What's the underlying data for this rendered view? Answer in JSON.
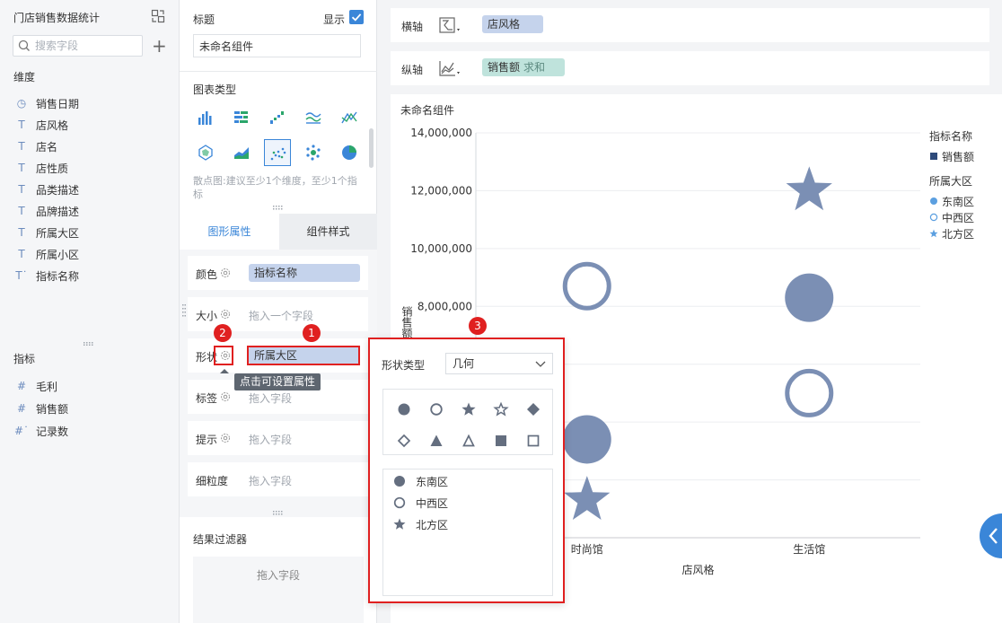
{
  "dataset": {
    "title": "门店销售数据统计",
    "search_placeholder": "搜索字段"
  },
  "dimensions": {
    "label": "维度",
    "items": [
      {
        "icon": "clock-icon",
        "label": "销售日期"
      },
      {
        "icon": "text-icon",
        "label": "店风格"
      },
      {
        "icon": "text-icon",
        "label": "店名"
      },
      {
        "icon": "text-icon",
        "label": "店性质"
      },
      {
        "icon": "text-icon",
        "label": "品类描述"
      },
      {
        "icon": "text-icon",
        "label": "品牌描述"
      },
      {
        "icon": "text-icon",
        "label": "所属大区"
      },
      {
        "icon": "text-icon",
        "label": "所属小区"
      },
      {
        "icon": "text-formula-icon",
        "label": "指标名称"
      }
    ]
  },
  "measures": {
    "label": "指标",
    "items": [
      {
        "icon": "hash-icon",
        "label": "毛利"
      },
      {
        "icon": "hash-icon",
        "label": "销售额"
      },
      {
        "icon": "hash-formula-icon",
        "label": "记录数"
      }
    ]
  },
  "config": {
    "title_label": "标题",
    "show_label": "显示",
    "show_checked": true,
    "component_name": "未命名组件",
    "chart_type_label": "图表类型",
    "chart_type_hint": "散点图:建议至少1个维度，至少1个指标",
    "tabs": [
      "图形属性",
      "组件样式"
    ],
    "attrs": {
      "color": {
        "label": "颜色",
        "value": "指标名称"
      },
      "size": {
        "label": "大小",
        "placeholder": "拖入一个字段"
      },
      "shape": {
        "label": "形状",
        "value": "所属大区"
      },
      "label": {
        "label": "标签",
        "placeholder": "拖入字段"
      },
      "tooltip": {
        "label": "提示",
        "placeholder": "拖入字段"
      },
      "granularity": {
        "label": "细粒度",
        "placeholder": "拖入字段"
      }
    },
    "tooltip_text": "点击可设置属性",
    "filter_label": "结果过滤器",
    "filter_placeholder": "拖入字段"
  },
  "axes": {
    "x_label": "横轴",
    "x_field": "店风格",
    "y_label": "纵轴",
    "y_field": "销售额",
    "y_agg": "求和"
  },
  "badges": [
    "1",
    "2",
    "3"
  ],
  "popup": {
    "shape_type_label": "形状类型",
    "shape_type_value": "几何",
    "mappings": [
      {
        "shape": "filled-circle",
        "label": "东南区"
      },
      {
        "shape": "hollow-circle",
        "label": "中西区"
      },
      {
        "shape": "star",
        "label": "北方区"
      }
    ]
  },
  "colors": {
    "accent": "#3a86d8",
    "marker": "#7b8fb4",
    "highlight": "#e02020"
  },
  "chart_data": {
    "type": "scatter",
    "title": "未命名组件",
    "xlabel": "店风格",
    "ylabel": "销售额",
    "categories": [
      "时尚馆",
      "生活馆"
    ],
    "ylim": [
      0,
      14000000
    ],
    "yticks": [
      8000000,
      10000000,
      12000000,
      14000000
    ],
    "ytick_labels": [
      "8,000,000",
      "10,000,000",
      "12,000,000",
      "14,000,000"
    ],
    "series": [
      {
        "name": "东南区",
        "shape": "filled-circle",
        "points": [
          [
            "时尚馆",
            3400000
          ],
          [
            "生活馆",
            8300000
          ]
        ]
      },
      {
        "name": "中西区",
        "shape": "hollow-circle",
        "points": [
          [
            "时尚馆",
            8700000
          ],
          [
            "生活馆",
            5000000
          ]
        ]
      },
      {
        "name": "北方区",
        "shape": "star",
        "points": [
          [
            "时尚馆",
            1300000
          ],
          [
            "生活馆",
            12000000
          ]
        ]
      }
    ],
    "legend": {
      "position": "right",
      "groups": [
        {
          "title": "指标名称",
          "items": [
            {
              "marker": "square",
              "label": "销售额"
            }
          ]
        },
        {
          "title": "所属大区",
          "items": [
            {
              "marker": "filled-circle",
              "label": "东南区"
            },
            {
              "marker": "hollow-circle",
              "label": "中西区"
            },
            {
              "marker": "star",
              "label": "北方区"
            }
          ]
        }
      ]
    }
  }
}
